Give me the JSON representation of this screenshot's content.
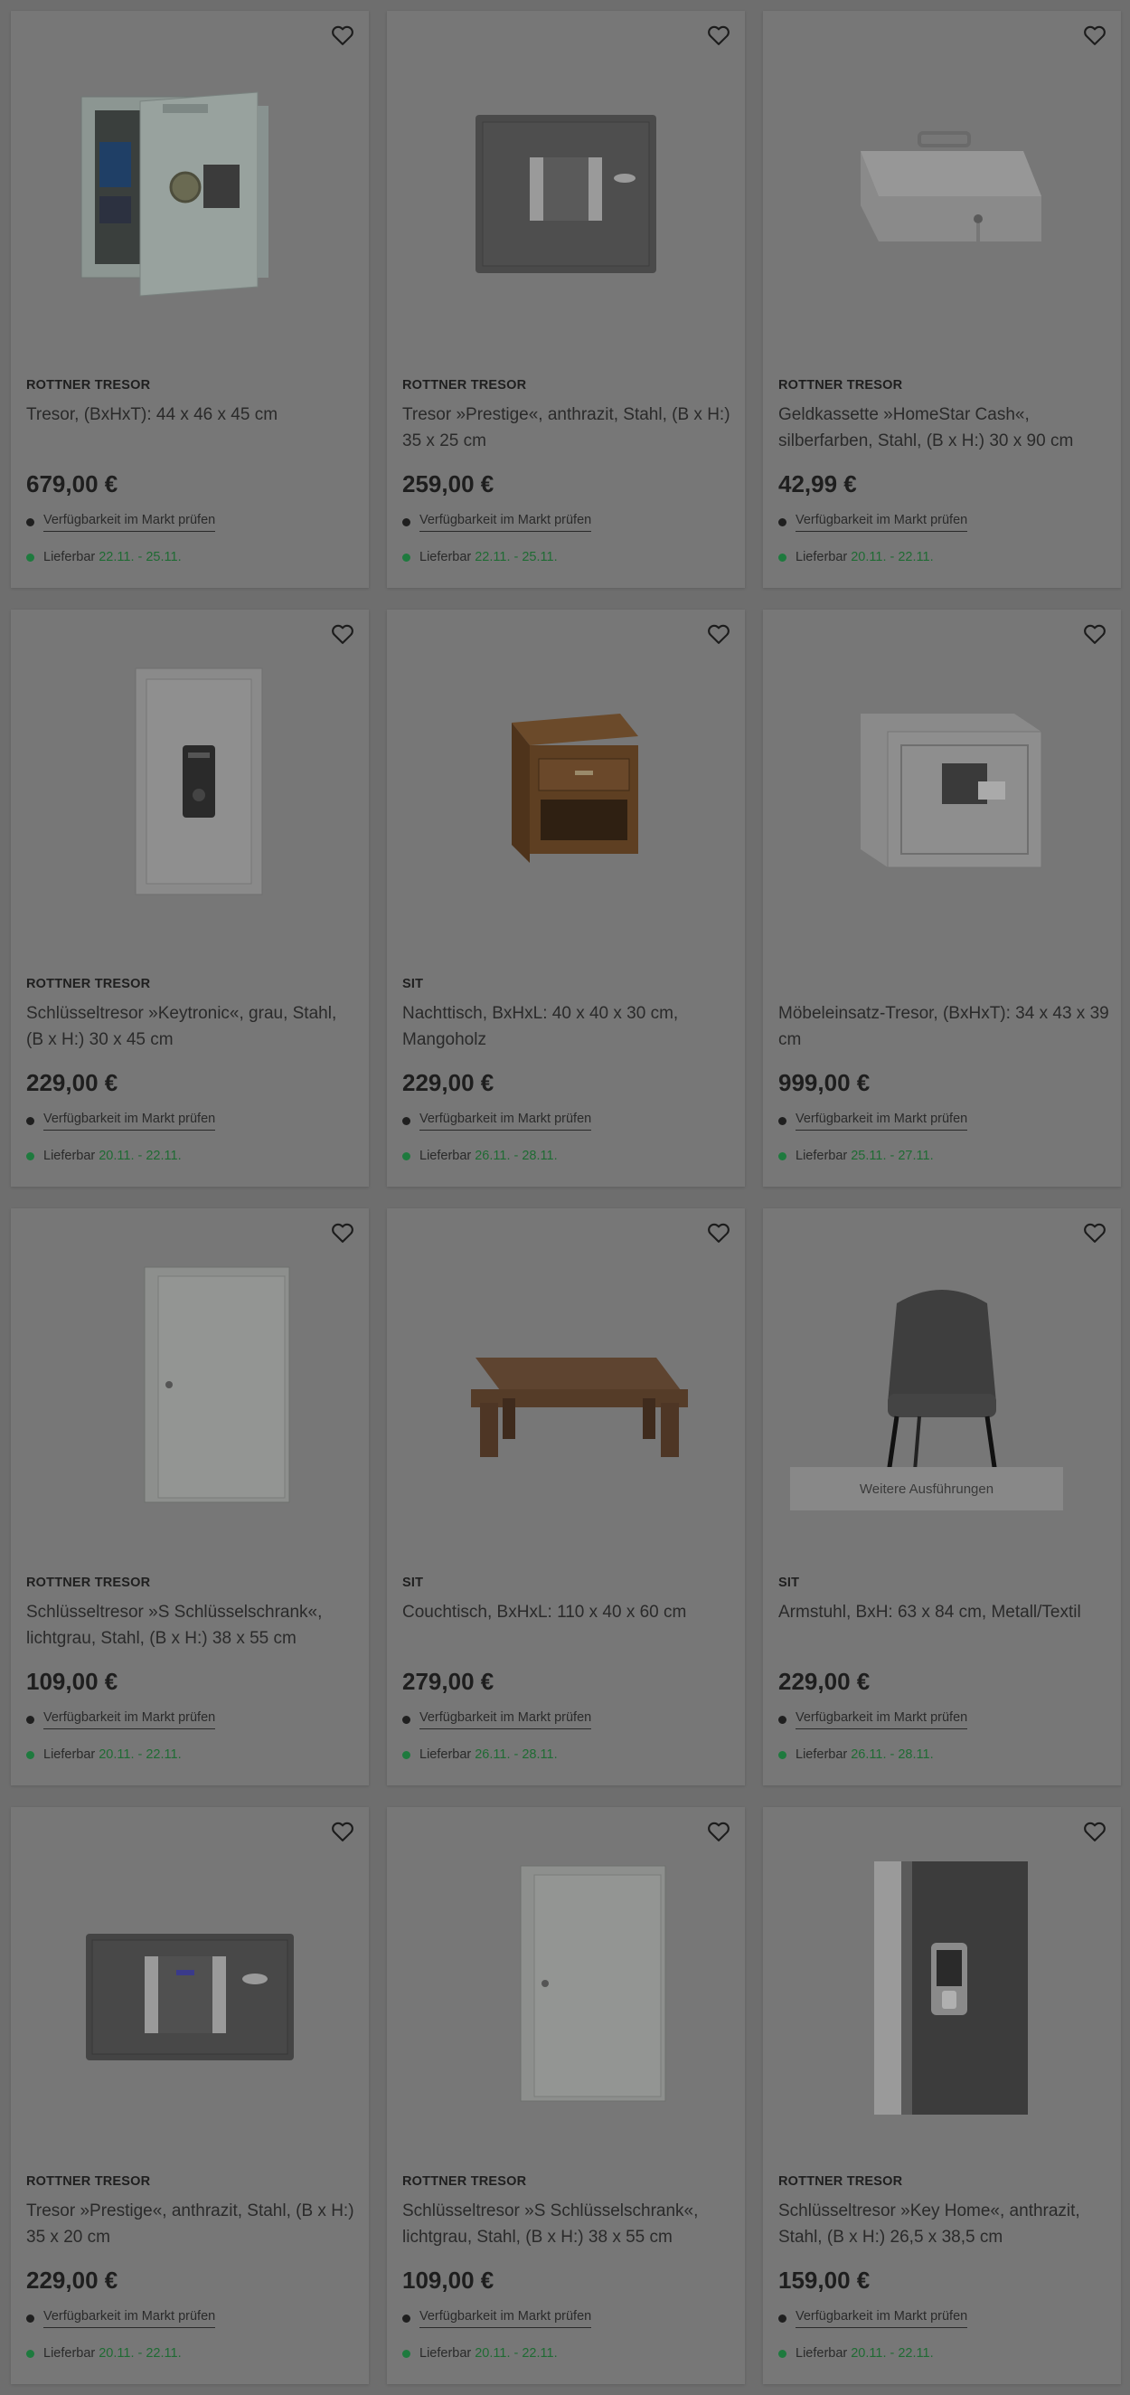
{
  "products": [
    {
      "brand": "ROTTNER TRESOR",
      "title": "Tresor, (BxHxT): 44 x 46 x 45 cm",
      "price": "679,00 €",
      "availability": "Verfügbarkeit im Markt prüfen",
      "delivery_label": "Lieferbar",
      "delivery_dates": "22.11. - 25.11.",
      "image": "safe-open-light-icon"
    },
    {
      "brand": "ROTTNER TRESOR",
      "title": "Tresor »Prestige«, anthrazit, Stahl, (B x H:) 35 x 25 cm",
      "price": "259,00 €",
      "availability": "Verfügbarkeit im Markt prüfen",
      "delivery_label": "Lieferbar",
      "delivery_dates": "22.11. - 25.11.",
      "image": "safe-dark-keypad-icon"
    },
    {
      "brand": "ROTTNER TRESOR",
      "title": "Geldkassette »HomeStar Cash«, silberfarben, Stahl, (B x H:) 30 x 90 cm",
      "price": "42,99 €",
      "availability": "Verfügbarkeit im Markt prüfen",
      "delivery_label": "Lieferbar",
      "delivery_dates": "20.11. - 22.11.",
      "image": "cash-box-icon"
    },
    {
      "brand": "ROTTNER TRESOR",
      "title": "Schlüsseltresor »Keytronic«, grau, Stahl, (B x H:) 30 x 45 cm",
      "price": "229,00 €",
      "availability": "Verfügbarkeit im Markt prüfen",
      "delivery_label": "Lieferbar",
      "delivery_dates": "20.11. - 22.11.",
      "image": "key-safe-keypad-icon"
    },
    {
      "brand": "SIT",
      "title": "Nachttisch, BxHxL: 40 x 40 x 30 cm, Mangoholz",
      "price": "229,00 €",
      "availability": "Verfügbarkeit im Markt prüfen",
      "delivery_label": "Lieferbar",
      "delivery_dates": "26.11. - 28.11.",
      "image": "nightstand-icon"
    },
    {
      "brand": "",
      "title": "Möbeleinsatz-Tresor, (BxHxT): 34 x 43 x 39 cm",
      "price": "999,00 €",
      "availability": "Verfügbarkeit im Markt prüfen",
      "delivery_label": "Lieferbar",
      "delivery_dates": "25.11. - 27.11.",
      "image": "safe-light-display-icon"
    },
    {
      "brand": "ROTTNER TRESOR",
      "title": "Schlüsseltresor »S Schlüsselschrank«, lichtgrau, Stahl, (B x H:) 38 x 55 cm",
      "price": "109,00 €",
      "availability": "Verfügbarkeit im Markt prüfen",
      "delivery_label": "Lieferbar",
      "delivery_dates": "20.11. - 22.11.",
      "image": "key-cabinet-icon"
    },
    {
      "brand": "SIT",
      "title": "Couchtisch, BxHxL: 110 x 40 x 60 cm",
      "price": "279,00 €",
      "availability": "Verfügbarkeit im Markt prüfen",
      "delivery_label": "Lieferbar",
      "delivery_dates": "26.11. - 28.11.",
      "image": "coffee-table-icon"
    },
    {
      "brand": "SIT",
      "title": "Armstuhl, BxH: 63 x 84 cm, Metall/Textil",
      "price": "229,00 €",
      "availability": "Verfügbarkeit im Markt prüfen",
      "delivery_label": "Lieferbar",
      "delivery_dates": "26.11. - 28.11.",
      "image": "armchair-icon",
      "variants_label": "Weitere Ausführungen"
    },
    {
      "brand": "ROTTNER TRESOR",
      "title": "Tresor »Prestige«, anthrazit, Stahl, (B x H:) 35 x 20 cm",
      "price": "229,00 €",
      "availability": "Verfügbarkeit im Markt prüfen",
      "delivery_label": "Lieferbar",
      "delivery_dates": "20.11. - 22.11.",
      "image": "safe-dark-wide-icon"
    },
    {
      "brand": "ROTTNER TRESOR",
      "title": "Schlüsseltresor »S Schlüsselschrank«, lichtgrau, Stahl, (B x H:) 38 x 55 cm",
      "price": "109,00 €",
      "availability": "Verfügbarkeit im Markt prüfen",
      "delivery_label": "Lieferbar",
      "delivery_dates": "20.11. - 22.11.",
      "image": "key-cabinet-icon"
    },
    {
      "brand": "ROTTNER TRESOR",
      "title": "Schlüsseltresor »Key Home«, anthrazit, Stahl, (B x H:) 26,5 x 38,5 cm",
      "price": "159,00 €",
      "availability": "Verfügbarkeit im Markt prüfen",
      "delivery_label": "Lieferbar",
      "delivery_dates": "20.11. - 22.11.",
      "image": "key-safe-dark-icon"
    }
  ],
  "colors": {
    "overlay_background": "#6e6e6e",
    "card": "#777777",
    "delivery_green": "#1f6b33"
  }
}
